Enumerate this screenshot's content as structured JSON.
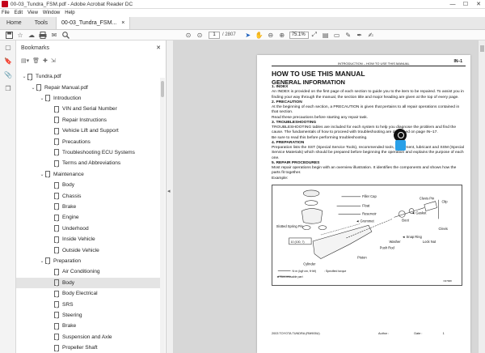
{
  "window": {
    "title": "00-03_Tundra_FSM.pdf - Adobe Acrobat Reader DC"
  },
  "menu": [
    "File",
    "Edit",
    "View",
    "Window",
    "Help"
  ],
  "tabs": {
    "home": "Home",
    "tools": "Tools",
    "doc": "00-03_Tundra_FSM...",
    "close": "×"
  },
  "toolbar": {
    "page_current": "1",
    "page_total": "/ 2807",
    "zoom": "75.1%"
  },
  "bookmarks": {
    "title": "Bookmarks",
    "items": [
      {
        "label": "Tundra.pdf",
        "level": 0,
        "toggle": "⌄"
      },
      {
        "label": "Repair Manual.pdf",
        "level": 1,
        "toggle": "⌄"
      },
      {
        "label": "Introduction",
        "level": 2,
        "toggle": "⌄"
      },
      {
        "label": "VIN and Serial Number",
        "level": 3,
        "toggle": ""
      },
      {
        "label": "Repair Instructions",
        "level": 3,
        "toggle": ""
      },
      {
        "label": "Vehicle Lift and Support",
        "level": 3,
        "toggle": ""
      },
      {
        "label": "Precautions",
        "level": 3,
        "toggle": ""
      },
      {
        "label": "Troubleshooting ECU Systems",
        "level": 3,
        "toggle": ""
      },
      {
        "label": "Terms and Abbreviations",
        "level": 3,
        "toggle": ""
      },
      {
        "label": "Maintenance",
        "level": 2,
        "toggle": "⌄"
      },
      {
        "label": "Body",
        "level": 3,
        "toggle": ""
      },
      {
        "label": "Chassis",
        "level": 3,
        "toggle": ""
      },
      {
        "label": "Brake",
        "level": 3,
        "toggle": ""
      },
      {
        "label": "Engine",
        "level": 3,
        "toggle": ""
      },
      {
        "label": "Underhood",
        "level": 3,
        "toggle": ""
      },
      {
        "label": "Inside Vehicle",
        "level": 3,
        "toggle": ""
      },
      {
        "label": "Outside Vehicle",
        "level": 3,
        "toggle": ""
      },
      {
        "label": "Preparation",
        "level": 2,
        "toggle": "⌄"
      },
      {
        "label": "Air Conditioning",
        "level": 3,
        "toggle": ""
      },
      {
        "label": "Body",
        "level": 3,
        "toggle": "",
        "selected": true
      },
      {
        "label": "Body Electrical",
        "level": 3,
        "toggle": ""
      },
      {
        "label": "SRS",
        "level": 3,
        "toggle": ""
      },
      {
        "label": "Steering",
        "level": 3,
        "toggle": ""
      },
      {
        "label": "Brake",
        "level": 3,
        "toggle": ""
      },
      {
        "label": "Suspension and Axle",
        "level": 3,
        "toggle": ""
      },
      {
        "label": "Propeller Shaft",
        "level": 3,
        "toggle": ""
      }
    ]
  },
  "page": {
    "header": "INTRODUCTION  –  HOW TO USE THIS MANUAL",
    "number": "IN–1",
    "h1": "HOW TO USE THIS MANUAL",
    "h2": "GENERAL INFORMATION",
    "s1_title": "1.      INDEX",
    "s1_text": "An INDEX is provided on the first page of each section to guide you to the item to be repaired. To assist you in finding your way through the manual, the section title and major heading are given at the top of every page.",
    "s2_title": "2.      PRECAUTION",
    "s2_text": "At the beginning of each section, a PRECAUTION is given that pertains to all repair operations contained in that section.",
    "s2_text2": "Read these precautions before starting any repair task.",
    "s3_title": "3.      TROUBLESHOOTING",
    "s3_text": "TROUBLESHOOTING tables are included for each system to help you diagnose the problem and find the cause. The fundamentals of how to proceed with troubleshooting are described on page IN–17.",
    "s3_text2": "Be sure to read this before performing troubleshooting.",
    "s4_title": "4.      PREPARATION",
    "s4_text": "Preparation lists the SST (Special Service Tools), recommended tools, equipment, lubricant and SSM (Special Service Materials) which should be prepared before beginning the operation and explains the purpose of each one.",
    "s5_title": "5.      REPAIR PROCEDURES",
    "s5_text": "Most repair operations begin with an overview illustration. It identifies the components and shows how the parts fit together.",
    "example": "Example:",
    "diagram_labels": {
      "filler_cap": "Filler Cap",
      "float": "Float",
      "reservoir": "Reservoir",
      "grommet": "◄ Grommet",
      "slotted_pin": "Slotted Spring Pin",
      "torque1": "10 (100, 7)",
      "cylinder": "Cylinder",
      "piston": "Piston",
      "push_rod": "Push Rod",
      "washer": "Washer",
      "snap_ring": "◄ Snap Ring",
      "boot": "Boot",
      "gasket": "◄ Gasket",
      "clevis_pin": "Clevis Pin",
      "clip": "Clip",
      "clevis": "Clevis",
      "lock_nut": "Lock Nut",
      "legend1_box": "N·m (kgf·cm, ft·lbf)",
      "legend1": ": Specified torque",
      "legend2": "◄ Non-reusable part",
      "fig_code": "N07688"
    },
    "footer_left": "2003 TOYOTA TUNDRA   (RM905U)",
    "footer_author": "Author :",
    "footer_date": "Date :",
    "footer_page": "1"
  }
}
